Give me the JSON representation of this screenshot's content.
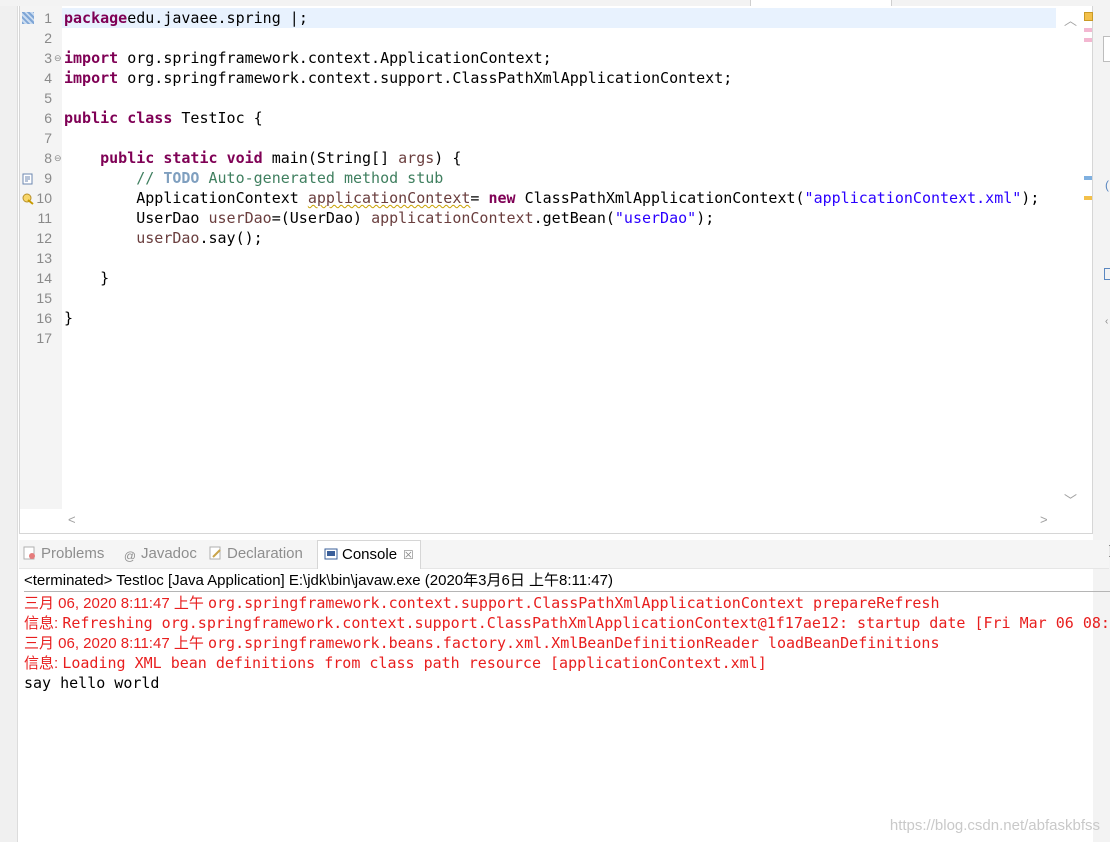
{
  "editor": {
    "lines": [
      {
        "no": "1",
        "parts": [
          [
            "kw",
            "package"
          ],
          [
            "",
            "edu.javaee.spring "
          ],
          [
            "",
            "|"
          ],
          [
            "",
            ";"
          ]
        ]
      },
      {
        "no": "2",
        "parts": []
      },
      {
        "no": "3",
        "fold": true,
        "parts": [
          [
            "kw",
            "import"
          ],
          [
            "",
            " org.springframework.context.ApplicationContext;"
          ]
        ]
      },
      {
        "no": "4",
        "parts": [
          [
            "kw",
            "import"
          ],
          [
            "",
            " org.springframework.context.support.ClassPathXmlApplicationContext;"
          ]
        ]
      },
      {
        "no": "5",
        "parts": []
      },
      {
        "no": "6",
        "parts": [
          [
            "kw",
            "public"
          ],
          [
            "",
            " "
          ],
          [
            "kw",
            "class"
          ],
          [
            "",
            " TestIoc {"
          ]
        ]
      },
      {
        "no": "7",
        "parts": []
      },
      {
        "no": "8",
        "fold": true,
        "parts": [
          [
            "",
            "    "
          ],
          [
            "kw",
            "public"
          ],
          [
            "",
            " "
          ],
          [
            "kw",
            "static"
          ],
          [
            "",
            " "
          ],
          [
            "kw",
            "void"
          ],
          [
            "",
            " main(String[] "
          ],
          [
            "var",
            "args"
          ],
          [
            "",
            ") {"
          ]
        ]
      },
      {
        "no": "9",
        "parts": [
          [
            "",
            "        "
          ],
          [
            "cm",
            "// "
          ],
          [
            "todo",
            "TODO"
          ],
          [
            "cm",
            " Auto-generated method stub"
          ]
        ]
      },
      {
        "no": "10",
        "parts": [
          [
            "",
            "        ApplicationContext "
          ],
          [
            "var warnline",
            "applicationContext"
          ],
          [
            "",
            "= "
          ],
          [
            "kw",
            "new"
          ],
          [
            "",
            " ClassPathXmlApplicationContext("
          ],
          [
            "str",
            "\"applicationContext.xml\""
          ],
          [
            "",
            ");"
          ]
        ]
      },
      {
        "no": "11",
        "parts": [
          [
            "",
            "        UserDao "
          ],
          [
            "var",
            "userDao"
          ],
          [
            "",
            "=(UserDao) "
          ],
          [
            "var",
            "applicationContext"
          ],
          [
            "",
            ".getBean("
          ],
          [
            "str",
            "\"userDao\""
          ],
          [
            "",
            ");"
          ]
        ]
      },
      {
        "no": "12",
        "parts": [
          [
            "",
            "        "
          ],
          [
            "var",
            "userDao"
          ],
          [
            "",
            ".say();"
          ]
        ]
      },
      {
        "no": "13",
        "parts": []
      },
      {
        "no": "14",
        "parts": [
          [
            "",
            "    }"
          ]
        ]
      },
      {
        "no": "15",
        "parts": []
      },
      {
        "no": "16",
        "parts": [
          [
            "",
            "}"
          ]
        ]
      },
      {
        "no": "17",
        "parts": []
      }
    ]
  },
  "console_tabs": [
    {
      "label": "Problems",
      "icon": "problems-icon"
    },
    {
      "label": "Javadoc",
      "icon": "javadoc-icon"
    },
    {
      "label": "Declaration",
      "icon": "declaration-icon"
    },
    {
      "label": "Console",
      "icon": "console-icon",
      "active": true
    }
  ],
  "console": {
    "header": "<terminated> TestIoc [Java Application] E:\\jdk\\bin\\javaw.exe (2020年3月6日 上午8:11:47)",
    "lines": [
      {
        "color": "red",
        "cjk": "三月 06, 2020 8:11:47 上午 ",
        "text": "org.springframework.context.support.ClassPathXmlApplicationContext prepareRefresh"
      },
      {
        "color": "red",
        "cjk": "信息: ",
        "text": "Refreshing org.springframework.context.support.ClassPathXmlApplicationContext@1f17ae12: startup date [Fri Mar 06 08:"
      },
      {
        "color": "red",
        "cjk": "三月 06, 2020 8:11:47 上午 ",
        "text": "org.springframework.beans.factory.xml.XmlBeanDefinitionReader loadBeanDefinitions"
      },
      {
        "color": "red",
        "cjk": "信息: ",
        "text": "Loading XML bean definitions from class path resource [applicationContext.xml]"
      },
      {
        "color": "black",
        "cjk": "",
        "text": "say hello world"
      }
    ]
  },
  "watermark": "https://blog.csdn.net/abfaskbfss"
}
